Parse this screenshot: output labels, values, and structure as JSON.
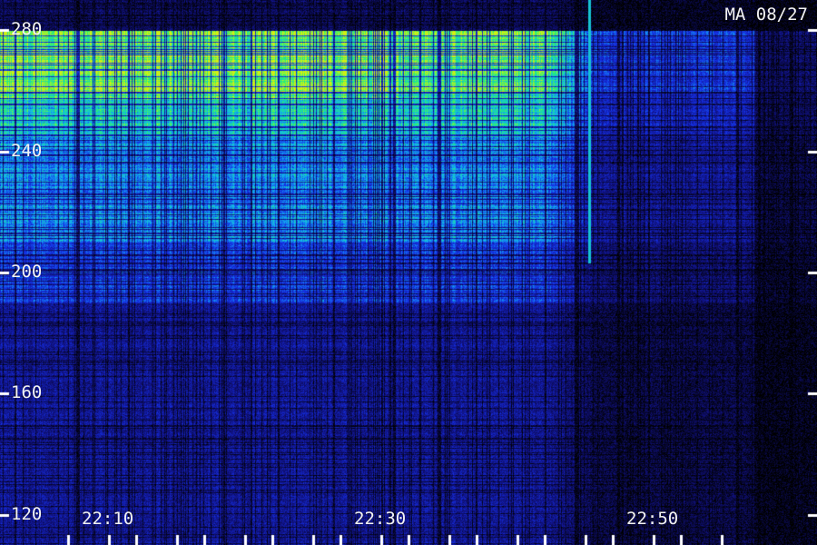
{
  "chart_data": {
    "type": "heatmap",
    "title": "MA 08/27",
    "xlabel": "",
    "ylabel": "",
    "x_range_minutes": [
      "22:02",
      "22:62"
    ],
    "x_tick_labels": [
      "22:10",
      "22:30",
      "22:50"
    ],
    "x_tick_label_values_min": [
      10,
      30,
      50
    ],
    "x_minor_tick_values_min": [
      7,
      10,
      12,
      15,
      17,
      20,
      22,
      25,
      27,
      30,
      32,
      35,
      37,
      40,
      42,
      45,
      47,
      50,
      52,
      55
    ],
    "x_minor_tick_start_min": 7,
    "x_minor_tick_step_min": 2.5,
    "x_axis_start_min": 2,
    "x_axis_end_min": 62,
    "y_range": [
      110,
      290
    ],
    "y_tick_labels": [
      "280",
      "240",
      "200",
      "160",
      "120"
    ],
    "y_tick_values": [
      280,
      240,
      200,
      160,
      120
    ],
    "intensity_levels": [
      {
        "y_from": 260,
        "y_to": 280,
        "level": 0.85
      },
      {
        "y_from": 245,
        "y_to": 260,
        "level": 0.7
      },
      {
        "y_from": 210,
        "y_to": 245,
        "level": 0.55
      },
      {
        "y_from": 190,
        "y_to": 210,
        "level": 0.4
      },
      {
        "y_from": 110,
        "y_to": 190,
        "level": 0.25
      }
    ],
    "time_fade_min": [
      42,
      46
    ],
    "bright_line_min": 45.3,
    "colorscale": [
      "#000000",
      "#10107a",
      "#1530e8",
      "#12b4f0",
      "#22f07a",
      "#d8f010"
    ],
    "grid": false,
    "legend": "none"
  }
}
